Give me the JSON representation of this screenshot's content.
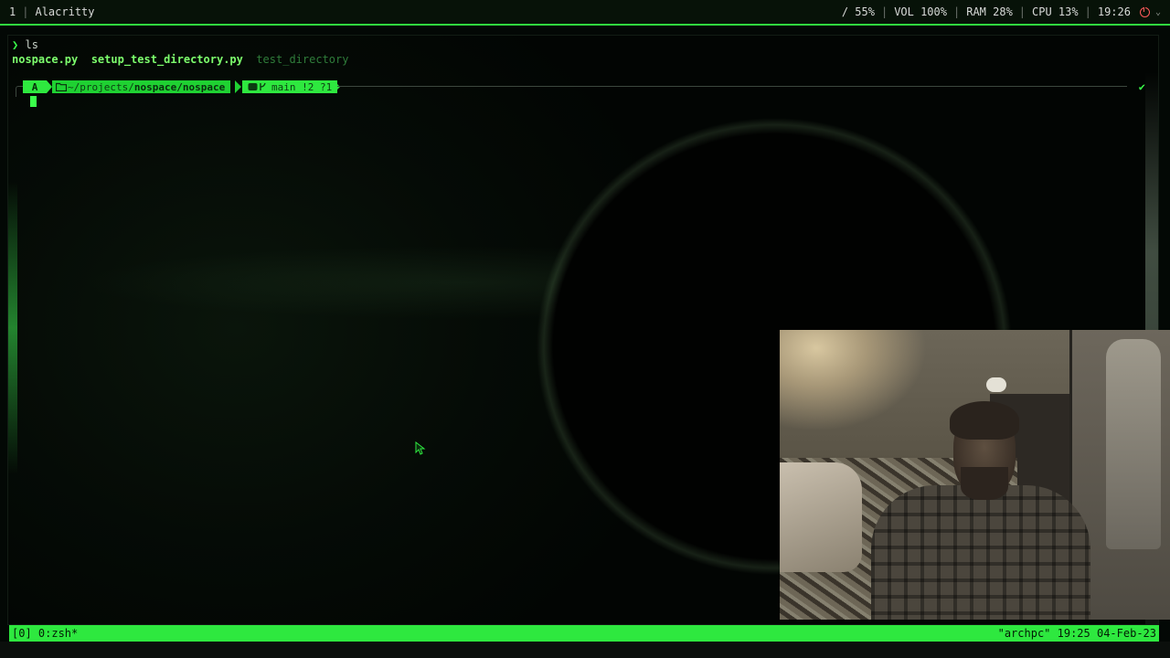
{
  "wm_bar": {
    "workspace": "1",
    "window_title": "Alacritty",
    "disk": "/ 55%",
    "volume": "VOL 100%",
    "ram": "RAM 28%",
    "cpu": "CPU 13%",
    "clock": "19:26"
  },
  "terminal": {
    "prompt_symbol": "❯",
    "command": "ls",
    "ls_output": {
      "files": [
        "nospace.py",
        "setup_test_directory.py"
      ],
      "directory": "test_directory"
    },
    "prompt": {
      "os_icon": "A",
      "folder_icon": "folder-icon",
      "path_prefix": "~/projects/",
      "path_repo": "nospace/nospace",
      "git_icon": "git-icon",
      "branch": "main !2 ?1",
      "status_check": "✔"
    }
  },
  "tmux": {
    "left": "[0] 0:zsh*",
    "right": "\"archpc\" 19:25 04-Feb-23"
  },
  "colors": {
    "accent": "#2ee83f",
    "prompt_green": "#3aff4a",
    "background": "#030805"
  }
}
